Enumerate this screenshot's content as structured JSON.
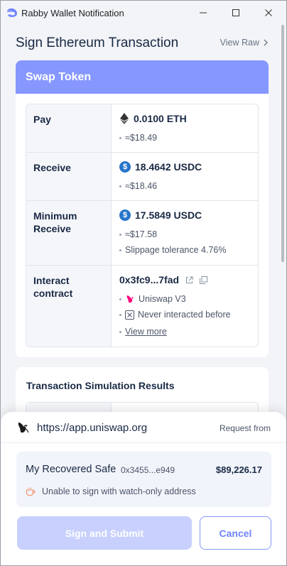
{
  "window": {
    "title": "Rabby Wallet Notification"
  },
  "header": {
    "title": "Sign Ethereum Transaction",
    "view_raw": "View Raw"
  },
  "swap": {
    "title": "Swap Token",
    "pay": {
      "label": "Pay",
      "token_icon": "ethereum-icon",
      "amount": "0.0100 ETH",
      "usd": "≈$18.49"
    },
    "receive": {
      "label": "Receive",
      "token_icon": "usdc-icon",
      "amount": "18.4642 USDC",
      "usd": "≈$18.46"
    },
    "minimum_receive": {
      "label_line1": "Minimum",
      "label_line2": "Receive",
      "token_icon": "usdc-icon",
      "amount": "17.5849 USDC",
      "usd": "≈$17.58",
      "slippage": "Slippage tolerance 4.76%"
    },
    "interact_contract": {
      "label_line1": "Interact",
      "label_line2": "contract",
      "address": "0x3fc9...7fad",
      "protocol": "Uniswap V3",
      "history": "Never interacted before",
      "view_more": "View more"
    }
  },
  "simulation": {
    "title": "Transaction Simulation Results"
  },
  "footer": {
    "origin_url": "https://app.uniswap.org",
    "request_from": "Request from",
    "account": {
      "name": "My Recovered Safe",
      "address": "0x3455...e949",
      "balance": "$89,226.17",
      "warning": "Unable to sign with watch-only address"
    },
    "sign_button": "Sign and Submit",
    "cancel_button": "Cancel"
  },
  "colors": {
    "accent": "#8697ff",
    "sign_disabled": "#c8d0fd",
    "usdc": "#2775ca",
    "uniswap": "#ff007a"
  }
}
